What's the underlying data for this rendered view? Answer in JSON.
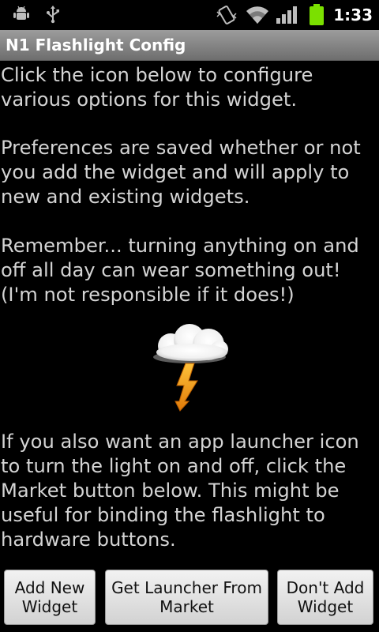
{
  "status_bar": {
    "time": "1:33",
    "icons": [
      "android-debug-icon",
      "usb-icon",
      "vibrate-icon",
      "wifi-icon",
      "signal-icon",
      "battery-icon"
    ]
  },
  "title_bar": {
    "title": "N1 Flashlight Config"
  },
  "body": {
    "para1": "Click the icon below to configure\nvarious options for this widget.",
    "para2": "Preferences are saved whether or not\nyou add the widget and will apply to\nnew and existing widgets.",
    "para3": "Remember... turning anything on and\noff all day can wear something out!\n(I'm not responsible if it does!)",
    "para4": "If you also want an app launcher icon\nto turn the light on and off, click the\nMarket button below. This might be\nuseful for binding the flashlight to\nhardware buttons."
  },
  "buttons": {
    "add_new": "Add New\nWidget",
    "get_launcher": "Get Launcher From\nMarket",
    "dont_add": "Don't Add\nWidget"
  },
  "colors": {
    "battery": "#7be000",
    "lightning": "#f7a21b",
    "text": "#d4d4d4",
    "title_bar": "#8a8a8a"
  }
}
